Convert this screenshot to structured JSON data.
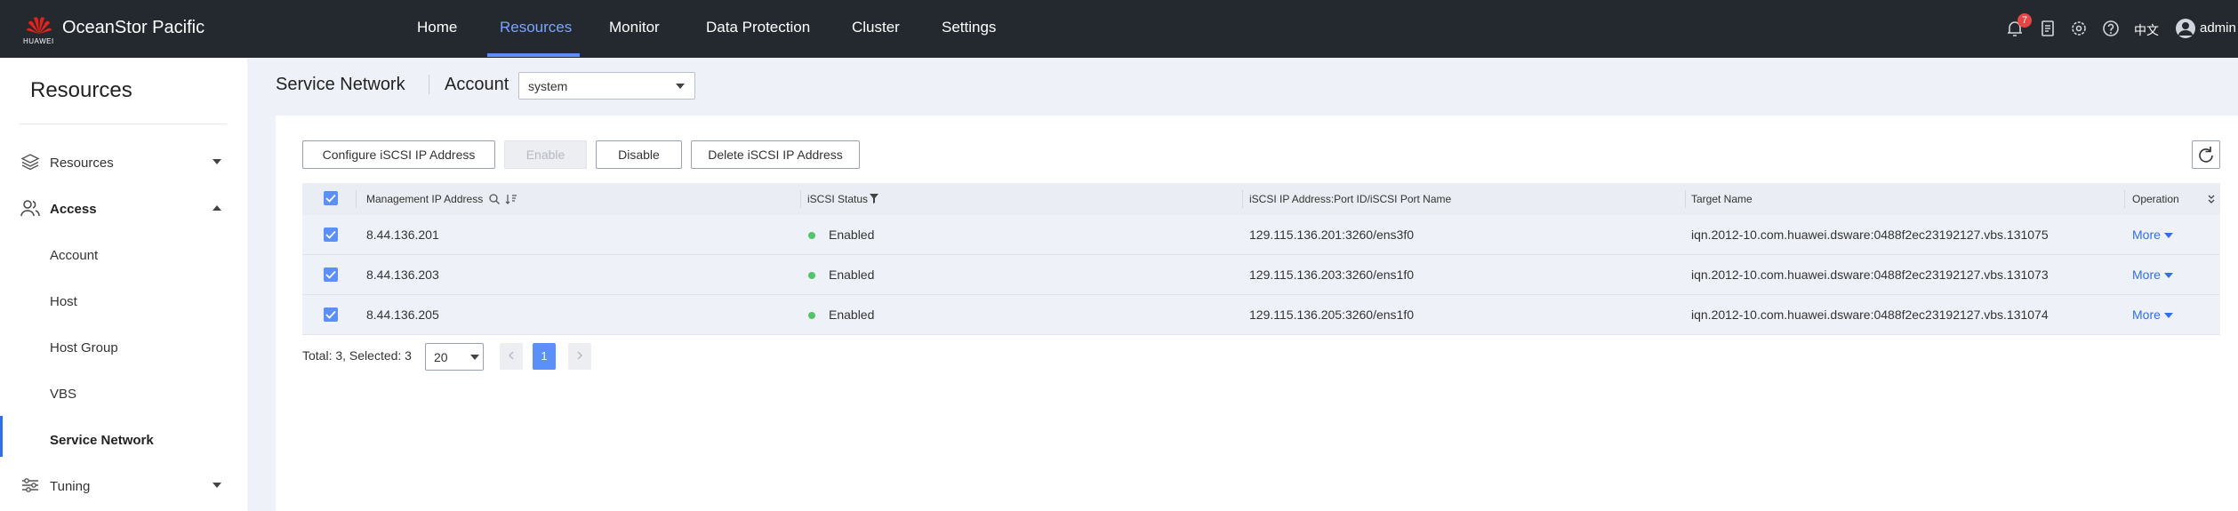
{
  "app": {
    "brand_name": "OceanStor Pacific",
    "brand_sub": "HUAWEI"
  },
  "topnav": {
    "items": [
      "Home",
      "Resources",
      "Monitor",
      "Data Protection",
      "Cluster",
      "Settings"
    ],
    "active": "Resources",
    "notification_count": "7",
    "language": "中文",
    "user": "admin"
  },
  "sidebar": {
    "title": "Resources",
    "groups": [
      {
        "label": "Resources",
        "icon": "layers-icon",
        "expanded": false
      },
      {
        "label": "Access",
        "icon": "users-icon",
        "expanded": true
      },
      {
        "label": "Tuning",
        "icon": "sliders-icon",
        "expanded": false
      }
    ],
    "access_items": [
      "Account",
      "Host",
      "Host Group",
      "VBS",
      "Service Network"
    ],
    "selected": "Service Network"
  },
  "header": {
    "title": "Service Network",
    "account_label": "Account",
    "account_value": "system"
  },
  "toolbar": {
    "configure": "Configure iSCSI IP Address",
    "enable": "Enable",
    "disable": "Disable",
    "delete": "Delete iSCSI IP Address"
  },
  "table": {
    "columns": [
      "Management IP Address",
      "iSCSI Status",
      "iSCSI IP Address:Port ID/iSCSI Port Name",
      "Target Name",
      "Operation"
    ],
    "rows": [
      {
        "mgmt_ip": "8.44.136.201",
        "status": "Enabled",
        "iscsi": "129.115.136.201:3260/ens3f0",
        "target": "iqn.2012-10.com.huawei.dsware:0488f2ec23192127.vbs.131075",
        "operation": "More"
      },
      {
        "mgmt_ip": "8.44.136.203",
        "status": "Enabled",
        "iscsi": "129.115.136.203:3260/ens1f0",
        "target": "iqn.2012-10.com.huawei.dsware:0488f2ec23192127.vbs.131073",
        "operation": "More"
      },
      {
        "mgmt_ip": "8.44.136.205",
        "status": "Enabled",
        "iscsi": "129.115.136.205:3260/ens1f0",
        "target": "iqn.2012-10.com.huawei.dsware:0488f2ec23192127.vbs.131074",
        "operation": "More"
      }
    ]
  },
  "pagination": {
    "summary": "Total: 3, Selected: 3",
    "page_size": "20",
    "current_page": "1"
  },
  "colors": {
    "accent": "#5b8ff9",
    "topbar": "#24292f",
    "status_enabled": "#52c46a"
  }
}
